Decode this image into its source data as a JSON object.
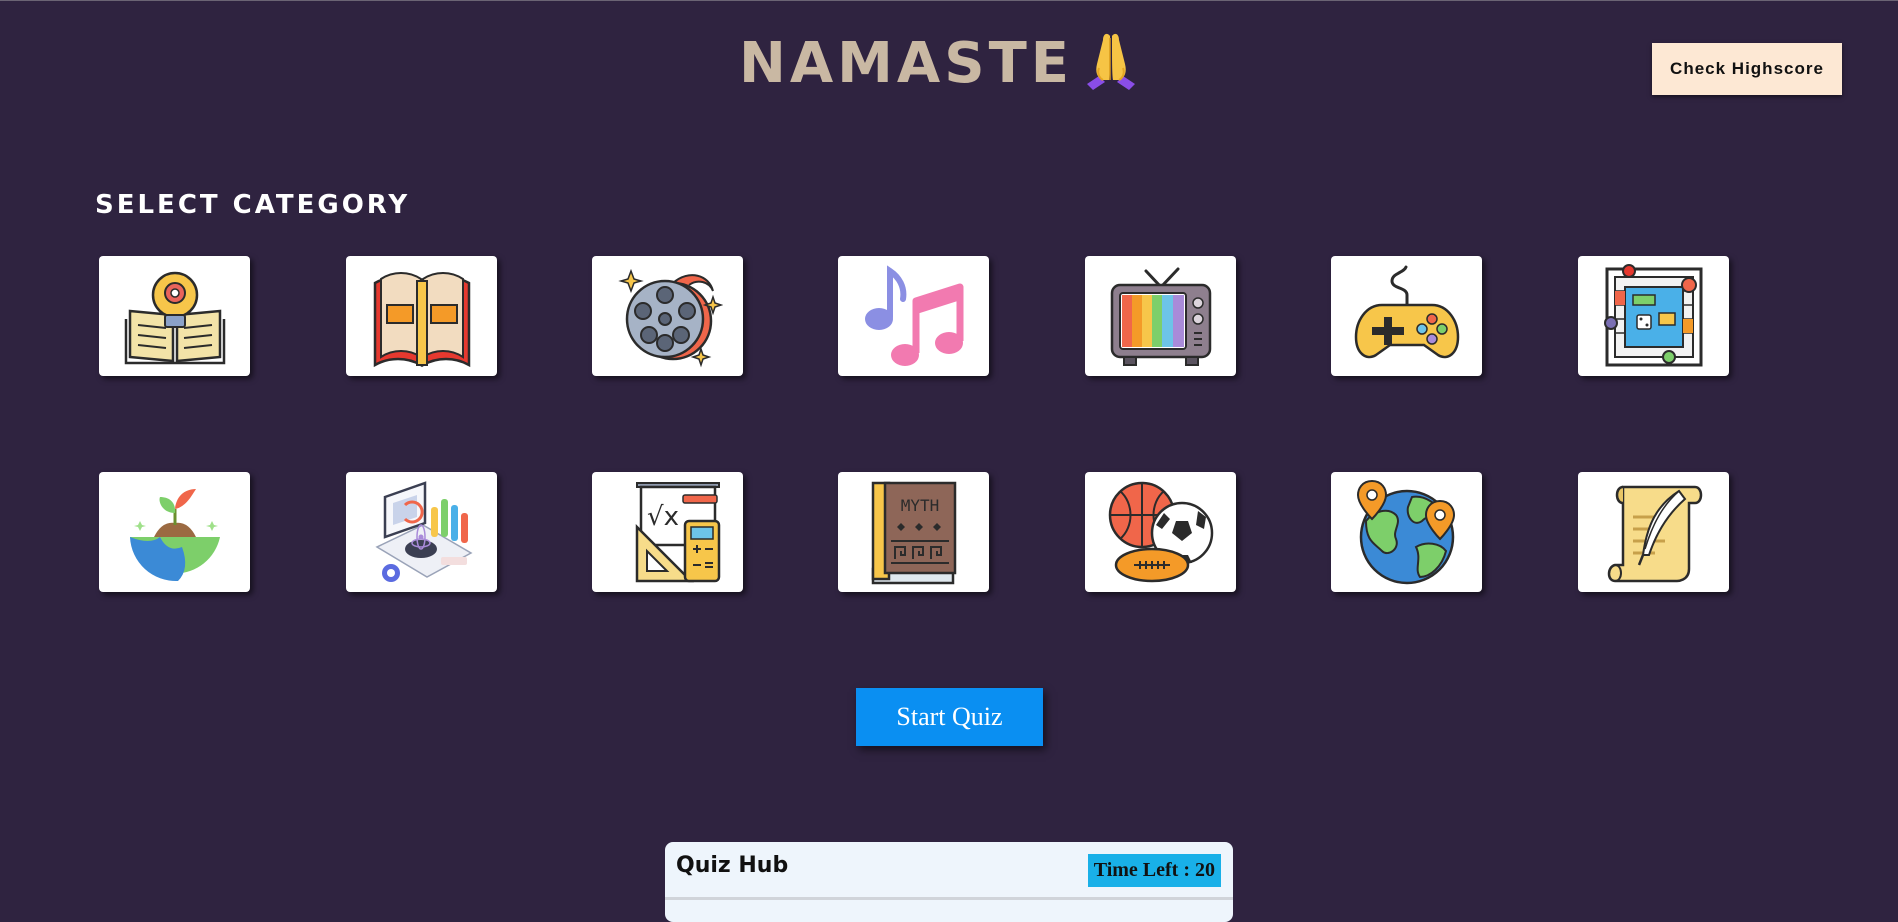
{
  "header": {
    "title": "NAMASTE",
    "title_emoji": "folded-hands",
    "highscore_label": "Check Highscore"
  },
  "category": {
    "title": "SELECT CATEGORY",
    "items": [
      {
        "icon": "general-knowledge-icon"
      },
      {
        "icon": "books-icon"
      },
      {
        "icon": "film-icon"
      },
      {
        "icon": "music-icon"
      },
      {
        "icon": "television-icon"
      },
      {
        "icon": "video-games-icon"
      },
      {
        "icon": "board-games-icon"
      },
      {
        "icon": "science-nature-icon"
      },
      {
        "icon": "computers-icon"
      },
      {
        "icon": "mathematics-icon"
      },
      {
        "icon": "mythology-icon"
      },
      {
        "icon": "sports-icon"
      },
      {
        "icon": "geography-icon"
      },
      {
        "icon": "history-icon"
      }
    ],
    "myth_label": "MYTH"
  },
  "actions": {
    "start_label": "Start Quiz"
  },
  "quiz": {
    "title": "Quiz Hub",
    "timer_label": "Time Left : 20"
  },
  "colors": {
    "background": "#2f2340",
    "title": "#c9b8a3",
    "highscore_bg": "#fde8d4",
    "start_bg": "#0a8ff2",
    "timer_bg": "#19b0e8"
  }
}
